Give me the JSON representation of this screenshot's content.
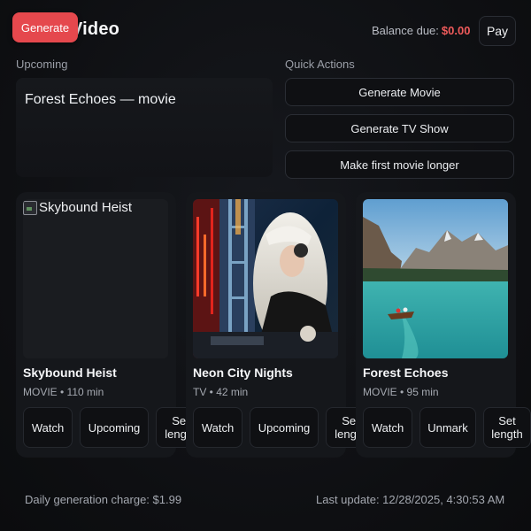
{
  "header": {
    "title_visible": "Video",
    "generate_badge": "Generate",
    "balance_label": "Balance due:",
    "balance_amount": "$0.00",
    "pay_label": "Pay"
  },
  "upcoming": {
    "label": "Upcoming",
    "items": [
      "Forest Echoes — movie"
    ]
  },
  "quick_actions": {
    "label": "Quick Actions",
    "buttons": [
      "Generate Movie",
      "Generate TV Show",
      "Make first movie longer"
    ]
  },
  "cards": [
    {
      "title": "Skybound Heist",
      "meta": "MOVIE • 110 min",
      "image_alt": "Skybound Heist",
      "image_state": "broken",
      "buttons": [
        "Watch",
        "Upcoming",
        "Set length"
      ]
    },
    {
      "title": "Neon City Nights",
      "meta": "TV • 42 min",
      "image_alt": "Neon City Nights",
      "image_state": "dj-photo",
      "buttons": [
        "Watch",
        "Upcoming",
        "Set length"
      ]
    },
    {
      "title": "Forest Echoes",
      "meta": "MOVIE • 95 min",
      "image_alt": "Forest Echoes",
      "image_state": "lake-photo",
      "buttons": [
        "Watch",
        "Unmark",
        "Set length"
      ]
    }
  ],
  "footer": {
    "daily_charge": "Daily generation charge: $1.99",
    "last_update": "Last update: 12/28/2025, 4:30:53 AM"
  },
  "colors": {
    "accent_red": "#e5484d",
    "balance_red": "#ef5b5b",
    "background": "#0e0f12"
  }
}
